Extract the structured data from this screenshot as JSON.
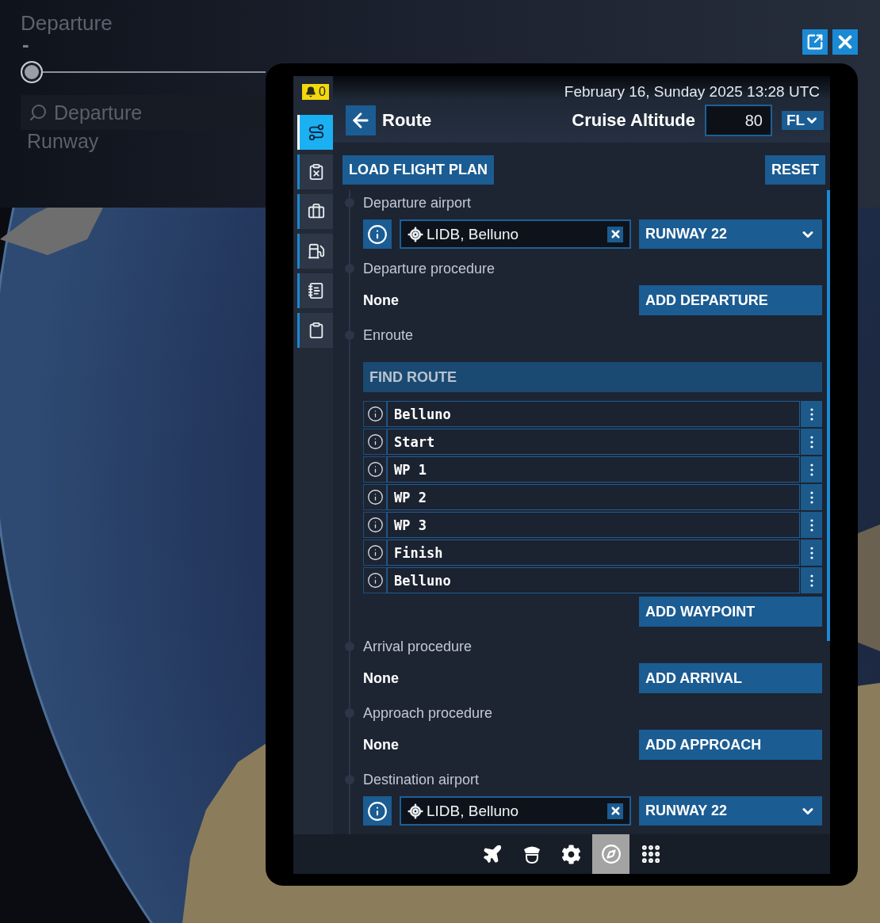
{
  "background_panel": {
    "title": "Departure",
    "value": "-",
    "slider": {
      "level": 0
    },
    "search": {
      "placeholder": "Departure"
    },
    "runway_label": "Runway"
  },
  "window_controls": [
    {
      "kind": "popout"
    },
    {
      "kind": "close"
    }
  ],
  "notifications": {
    "count": "0"
  },
  "sidebar": {
    "items": [
      {
        "kind": "route",
        "selected": true
      },
      {
        "kind": "checklist",
        "selected": false
      },
      {
        "kind": "briefcase",
        "selected": false
      },
      {
        "kind": "fuel",
        "selected": false
      },
      {
        "kind": "document",
        "selected": false
      },
      {
        "kind": "clipboard",
        "selected": false
      }
    ]
  },
  "header": {
    "datetime": "February 16, Sunday 2025 13:28 UTC",
    "title": "Route",
    "cruise_altitude": {
      "label": "Cruise Altitude",
      "value": "80",
      "unit": "FL"
    }
  },
  "actions": {
    "load": "LOAD FLIGHT PLAN",
    "reset": "RESET"
  },
  "sections": [
    {
      "kind": "airport",
      "label": "Departure airport",
      "airport": "LIDB, Belluno",
      "runway": "RUNWAY 22"
    },
    {
      "kind": "procedure",
      "label": "Departure procedure",
      "value": "None",
      "button": "ADD DEPARTURE"
    },
    {
      "kind": "enroute",
      "label": "Enroute",
      "find_route": "FIND ROUTE",
      "waypoints": [
        "Belluno",
        "Start",
        "WP 1",
        "WP 2",
        "WP 3",
        "Finish",
        "Belluno"
      ],
      "button": "ADD WAYPOINT"
    },
    {
      "kind": "procedure",
      "label": "Arrival procedure",
      "value": "None",
      "button": "ADD ARRIVAL"
    },
    {
      "kind": "procedure",
      "label": "Approach procedure",
      "value": "None",
      "button": "ADD APPROACH"
    },
    {
      "kind": "airport",
      "label": "Destination airport",
      "airport": "LIDB, Belluno",
      "runway": "RUNWAY 22"
    }
  ],
  "toolbar": {
    "items": [
      {
        "kind": "plane",
        "selected": false
      },
      {
        "kind": "pilot",
        "selected": false
      },
      {
        "kind": "settings",
        "selected": false
      },
      {
        "kind": "compass",
        "selected": true
      },
      {
        "kind": "apps",
        "selected": false
      }
    ]
  }
}
